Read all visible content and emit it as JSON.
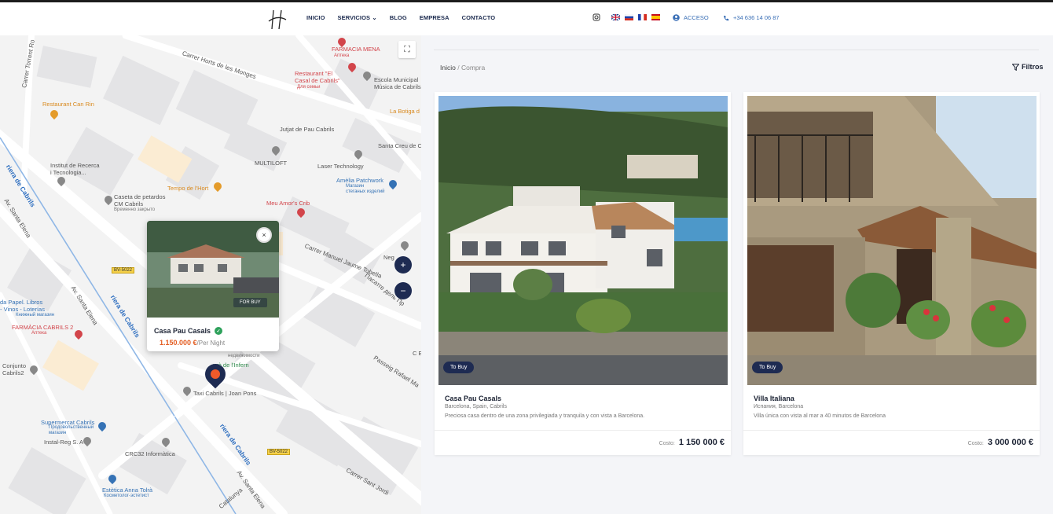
{
  "header": {
    "nav": [
      "INICIO",
      "SERVICIOS",
      "BLOG",
      "EMPRESA",
      "CONTACTO"
    ],
    "acceso": "ACCESO",
    "phone": "+34 636 14 06 87",
    "languages": [
      "en",
      "ru",
      "fr",
      "es"
    ]
  },
  "map": {
    "labels": {
      "farmacia_mena": "FARMACIA MENA",
      "farmacia_mena_ru": "Аптека",
      "restaurant_casal": "Restaurant \"El\nCasal de Cabrils\"",
      "restaurant_casal_ru": "Для семьи",
      "escola": "Escola Municipal\nMúsica de Cabrils",
      "carrer_horts": "Carrer Horts de les Monges",
      "carrer_torrent": "Carrer Torrent Ro",
      "restaurant_can_rin": "Restaurant Can Rin",
      "la_botiga": "La Botiga d",
      "jutjat": "Jutjat de Pau Cabrils",
      "santa_creu": "Santa Creu de C",
      "multiloft": "MULTILOFT",
      "laser": "Laser Technology",
      "institut": "Institut de Recerca\ni Tecnologia...",
      "tempo": "Tempo de l'Hort",
      "amelia": "Amèlia Patchwork",
      "amelia_ru": "Магазин\nстеганых изделий",
      "caseta": "Caseta de petardos\nCM Cabrils",
      "caseta_ru": "Временно закрыто",
      "meu_amor": "Meu Amor's Crib",
      "riera1": "riera de Cabrils",
      "av_santa_elena1": "Av. Santa Elena",
      "carrer_manuel": "Carrer Manuel Jaume Tobella",
      "neg": "Neg",
      "pasatge": "Пасатге дель Пр",
      "bv5022_1": "BV-5022",
      "av_santa_elena2": "Av. Santa Elena",
      "riera2": "riera de Cabrils",
      "papel": "da Papel. Libros\n- Vinos - Loterías",
      "papel_ru": "Книжный магазин",
      "farmacia_cabrils": "FARMÀCIA CABRILS 2",
      "farmacia_cabrils_ru": "Аптека",
      "agentstvo": "Агентство\nнедвижимости",
      "infern": "urò de l'Infern",
      "c_e": "C E",
      "passeig_rafael": "Passeig Rafael Ma",
      "conjunto": "Conjunto\nCabrils2",
      "taxi": "Taxi Cabrils | Joan Pons",
      "supermercat": "Supermercat Cabrils",
      "supermercat_ru": "Продовольственный\nмагазин",
      "instal": "Instal-Reg S. A",
      "crc32": "CRC32 Informàtica",
      "bv5022_2": "BV-5022",
      "riera3": "riera de Cabrils",
      "av_santa_elena3": "Av. Santa Elena",
      "carrer_sant_jordi": "Carrer Sant Jordi",
      "estetica": "Estètica Anna Tolrà",
      "estetica_ru": "Косметолог-эстетист",
      "catalunya": "Catalunya"
    },
    "zoom_in": "+",
    "zoom_out": "−",
    "popup": {
      "title": "Casa Pau Casals",
      "tag": "FOR BUY",
      "price": "1.150.000 €",
      "price_unit": "/Per Night",
      "close": "×"
    }
  },
  "listing": {
    "breadcrumb_home": "Inicio",
    "breadcrumb_sep": "/",
    "breadcrumb_current": "Compra",
    "filters_label": "Filtros",
    "cards": [
      {
        "badge": "To Buy",
        "name": "Casa Pau Casals",
        "location": "Barcelona, Spain, Cabrils",
        "description": "Preciosa casa dentro de una zona privilegiada y tranquila y con vista a Barcelona.",
        "cost_label": "Costo:",
        "cost": "1 150 000 €"
      },
      {
        "badge": "To Buy",
        "name": "Villa Italiana",
        "location": "Испания, Barcelona",
        "description": "Villa única con vista al mar a 40 minutos de Barcelona",
        "cost_label": "Costo:",
        "cost": "3 000 000 €"
      }
    ]
  }
}
